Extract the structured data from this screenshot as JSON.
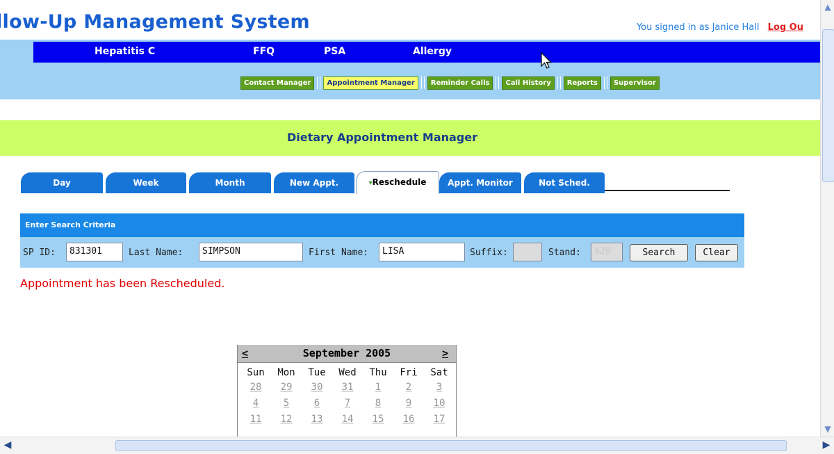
{
  "header": {
    "title": "llow-Up Management System",
    "signed_in_text": "You signed in as Janice Hall",
    "logout_label": "Log Ou"
  },
  "primary_nav": [
    "Hepatitis C",
    "FFQ",
    "PSA",
    "Allergy"
  ],
  "sub_nav": [
    {
      "label": "Contact Manager",
      "active": false
    },
    {
      "label": "Appointment Manager",
      "active": true
    },
    {
      "label": "Reminder Calls",
      "active": false
    },
    {
      "label": "Call History",
      "active": false
    },
    {
      "label": "Reports",
      "active": false
    },
    {
      "label": "Supervisor",
      "active": false
    }
  ],
  "banner_title": "Dietary Appointment Manager",
  "tabs": [
    {
      "label": "Day"
    },
    {
      "label": "Week"
    },
    {
      "label": "Month"
    },
    {
      "label": "New Appt."
    },
    {
      "label": "Reschedule",
      "marker": "▾",
      "active": true
    },
    {
      "label": "Appt. Monitor"
    },
    {
      "label": "Not Sched."
    }
  ],
  "search": {
    "header": "Enter Search Criteria",
    "sp_id_label": "SP ID:",
    "sp_id_value": "831301",
    "last_name_label": "Last Name:",
    "last_name_value": "SIMPSON",
    "first_name_label": "First Name:",
    "first_name_value": "LISA",
    "suffix_label": "Suffix:",
    "suffix_value": "",
    "stand_label": "Stand:",
    "stand_value": "420",
    "search_button": "Search",
    "clear_button": "Clear"
  },
  "status_message": "Appointment has been Rescheduled.",
  "calendar": {
    "prev": "<",
    "next": ">",
    "month_label": "September 2005",
    "weekdays": [
      "Sun",
      "Mon",
      "Tue",
      "Wed",
      "Thu",
      "Fri",
      "Sat"
    ],
    "weeks": [
      [
        "28",
        "29",
        "30",
        "31",
        "1",
        "2",
        "3"
      ],
      [
        "4",
        "5",
        "6",
        "7",
        "8",
        "9",
        "10"
      ],
      [
        "11",
        "12",
        "13",
        "14",
        "15",
        "16",
        "17"
      ]
    ]
  },
  "colors": {
    "primary_nav_bg": "#0000f0",
    "nav_band_bg": "#9ed1f3",
    "sub_nav_bg": "#5f9f20",
    "sub_nav_active_bg": "#f6ff6a",
    "banner_bg": "#ccff66",
    "tab_bg": "#1875d8",
    "status_red": "#e00000"
  }
}
